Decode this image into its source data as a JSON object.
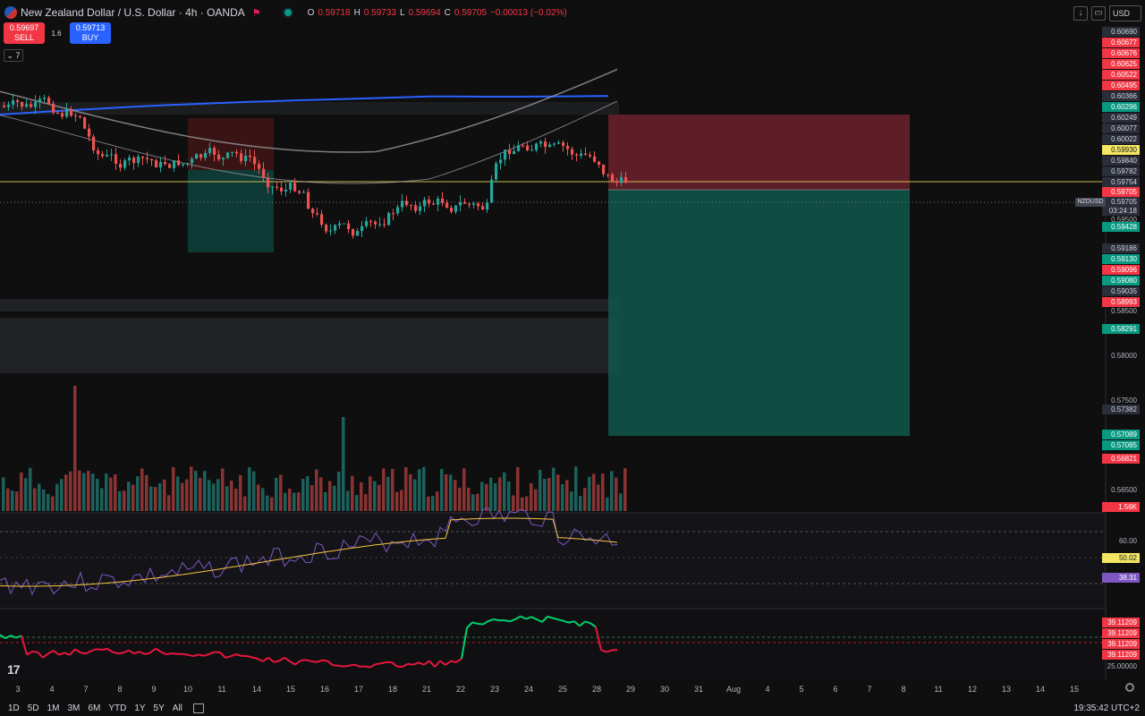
{
  "header": {
    "symbol_title": "New Zealand Dollar / U.S. Dollar · 4h · OANDA",
    "ohlc": [
      {
        "k": "O",
        "v": "0.59718"
      },
      {
        "k": "H",
        "v": "0.59733"
      },
      {
        "k": "L",
        "v": "0.59694"
      },
      {
        "k": "C",
        "v": "0.59705"
      },
      {
        "k": "",
        "v": "−0.00013 (−0.02%)"
      }
    ],
    "currency": "USD"
  },
  "trade": {
    "sell_price": "0.59697",
    "sell_label": "SELL",
    "spread": "1.6",
    "buy_price": "0.59713",
    "buy_label": "BUY"
  },
  "indicator_toggle": "7",
  "symbol_tag": "NZDUSD",
  "countdown": "03:24:18",
  "price_labels": [
    {
      "text": "0.60690",
      "style": "dark"
    },
    {
      "text": "0.60677",
      "style": "red"
    },
    {
      "text": "0.60676",
      "style": "red"
    },
    {
      "text": "0.60625",
      "style": "red"
    },
    {
      "text": "0.60522",
      "style": "red"
    },
    {
      "text": "0.60495",
      "style": "red"
    },
    {
      "text": "0.60366",
      "style": "dark"
    },
    {
      "text": "0.60296",
      "style": "teal"
    },
    {
      "text": "0.60249",
      "style": "dark"
    },
    {
      "text": "0.60077",
      "style": "dark"
    },
    {
      "text": "0.60022",
      "style": "dark"
    },
    {
      "text": "0.59930",
      "style": "yellow"
    },
    {
      "text": "0.59840",
      "style": "dark"
    },
    {
      "text": "0.59782",
      "style": "dark"
    },
    {
      "text": "0.59754",
      "style": "dark"
    },
    {
      "text": "0.59705",
      "style": "red"
    },
    {
      "text": "0.59705",
      "style": "dark"
    },
    {
      "text": "0.59500",
      "style": "plain"
    },
    {
      "text": "0.59428",
      "style": "teal"
    },
    {
      "text": "0.59186",
      "style": "dark"
    },
    {
      "text": "0.59130",
      "style": "teal"
    },
    {
      "text": "0.59096",
      "style": "red"
    },
    {
      "text": "0.59080",
      "style": "teal"
    },
    {
      "text": "0.59035",
      "style": "dark"
    },
    {
      "text": "0.58993",
      "style": "red"
    },
    {
      "text": "0.58500",
      "style": "plain"
    },
    {
      "text": "0.58291",
      "style": "teal"
    },
    {
      "text": "0.58000",
      "style": "plain"
    },
    {
      "text": "0.57500",
      "style": "plain"
    },
    {
      "text": "0.57382",
      "style": "dark"
    },
    {
      "text": "0.57089",
      "style": "teal"
    },
    {
      "text": "0.57085",
      "style": "teal"
    },
    {
      "text": "0.56821",
      "style": "red"
    },
    {
      "text": "0.56500",
      "style": "plain"
    },
    {
      "text": "1.56K",
      "style": "red"
    }
  ],
  "rsi_labels": [
    {
      "text": "60.00",
      "style": "plain"
    },
    {
      "text": "50.02",
      "style": "yellow"
    },
    {
      "text": "38.31",
      "style": "purple"
    }
  ],
  "osc_labels": [
    {
      "text": "39.11209",
      "style": "red"
    },
    {
      "text": "39.11209",
      "style": "red"
    },
    {
      "text": "39.11209",
      "style": "red"
    },
    {
      "text": "39.11209",
      "style": "red"
    },
    {
      "text": "25.00000",
      "style": "plain"
    }
  ],
  "x_axis": [
    "3",
    "4",
    "7",
    "8",
    "9",
    "10",
    "11",
    "14",
    "15",
    "16",
    "17",
    "18",
    "21",
    "22",
    "23",
    "24",
    "25",
    "28",
    "29",
    "30",
    "31",
    "Aug",
    "4",
    "5",
    "6",
    "7",
    "8",
    "11",
    "12",
    "13",
    "14",
    "15"
  ],
  "timeframes": [
    "1D",
    "5D",
    "1M",
    "3M",
    "6M",
    "YTD",
    "1Y",
    "5Y",
    "All"
  ],
  "clock": "19:35:42 UTC+2",
  "colors": {
    "up": "#26a69a",
    "down": "#ef5350",
    "ma_blue": "#2962ff",
    "rsi": "#7e57c2",
    "rsi_ma": "#f5c542",
    "osc_up": "#00e676",
    "osc_down": "#ff1744"
  }
}
